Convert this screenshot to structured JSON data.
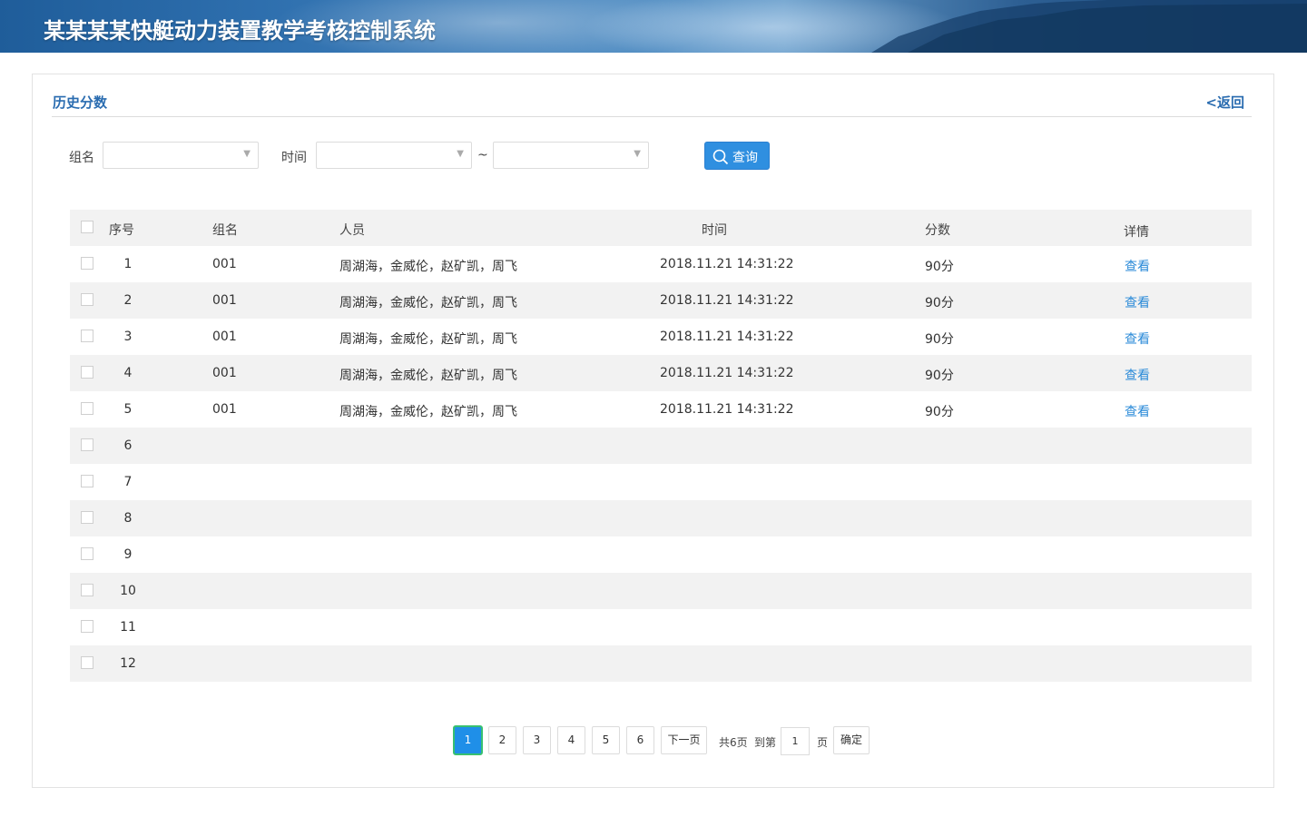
{
  "app": {
    "title": "某某某某快艇动力装置教学考核控制系统"
  },
  "panel": {
    "title": "历史分数",
    "back_label": "<返回"
  },
  "filter": {
    "group_label": "组名",
    "group_value": "",
    "time_label": "时间",
    "time_start": "",
    "time_end": "",
    "tilde": "~",
    "query_label": "查询"
  },
  "table": {
    "headers": {
      "index": "序号",
      "group": "组名",
      "people": "人员",
      "time": "时间",
      "score": "分数",
      "detail": "详情"
    },
    "rows": [
      {
        "index": "1",
        "group": "001",
        "people": "周湖海，金威伦，赵矿凯，周飞",
        "time": "2018.11.21  14:31:22",
        "score": "90分",
        "detail": "查看"
      },
      {
        "index": "2",
        "group": "001",
        "people": "周湖海，金威伦，赵矿凯，周飞",
        "time": "2018.11.21  14:31:22",
        "score": "90分",
        "detail": "查看"
      },
      {
        "index": "3",
        "group": "001",
        "people": "周湖海，金威伦，赵矿凯，周飞",
        "time": "2018.11.21  14:31:22",
        "score": "90分",
        "detail": "查看"
      },
      {
        "index": "4",
        "group": "001",
        "people": "周湖海，金威伦，赵矿凯，周飞",
        "time": "2018.11.21  14:31:22",
        "score": "90分",
        "detail": "查看"
      },
      {
        "index": "5",
        "group": "001",
        "people": "周湖海，金威伦，赵矿凯，周飞",
        "time": "2018.11.21  14:31:22",
        "score": "90分",
        "detail": "查看"
      },
      {
        "index": "6",
        "group": "",
        "people": "",
        "time": "",
        "score": "",
        "detail": ""
      },
      {
        "index": "7",
        "group": "",
        "people": "",
        "time": "",
        "score": "",
        "detail": ""
      },
      {
        "index": "8",
        "group": "",
        "people": "",
        "time": "",
        "score": "",
        "detail": ""
      },
      {
        "index": "9",
        "group": "",
        "people": "",
        "time": "",
        "score": "",
        "detail": ""
      },
      {
        "index": "10",
        "group": "",
        "people": "",
        "time": "",
        "score": "",
        "detail": ""
      },
      {
        "index": "11",
        "group": "",
        "people": "",
        "time": "",
        "score": "",
        "detail": ""
      },
      {
        "index": "12",
        "group": "",
        "people": "",
        "time": "",
        "score": "",
        "detail": ""
      }
    ]
  },
  "pagination": {
    "pages": [
      "1",
      "2",
      "3",
      "4",
      "5",
      "6"
    ],
    "current_page": "1",
    "next_label": "下一页",
    "total_text": "共6页",
    "goto_label": "到第",
    "goto_value": "1",
    "page_suffix": "页",
    "confirm_label": "确定"
  },
  "colors": {
    "accent": "#2a6cb0",
    "button": "#2f8fe0",
    "link": "#2a8ad8",
    "row_alt": "#f2f2f2"
  }
}
